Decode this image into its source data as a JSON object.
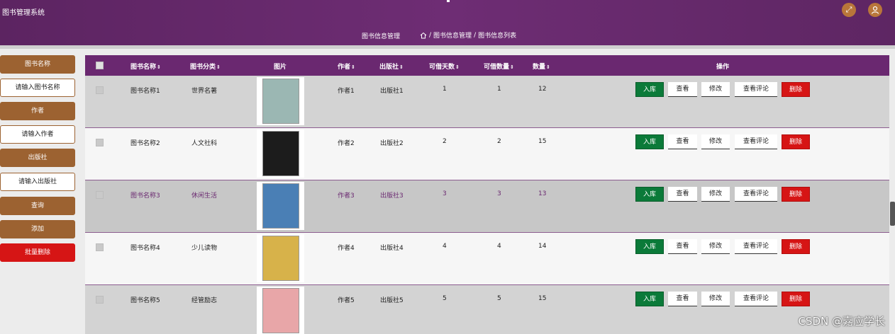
{
  "header": {
    "app_title": "图书管理系统",
    "nav_label": "图书信息管理",
    "breadcrumb": [
      "图书信息管理",
      "图书信息列表"
    ],
    "icons": [
      "fullscreen-icon",
      "user-icon"
    ],
    "accent_color": "#6a2870"
  },
  "sidebar": {
    "title_label": "图书名称",
    "title_placeholder": "请输入图书名称",
    "author_label": "作者",
    "author_placeholder": "请输入作者",
    "publisher_label": "出版社",
    "publisher_placeholder": "请输入出版社",
    "query_button": "查询",
    "add_button": "添加",
    "batch_delete_button": "批量删除"
  },
  "table": {
    "columns": {
      "name": "图书名称",
      "category": "图书分类",
      "image": "图片",
      "author": "作者",
      "publisher": "出版社",
      "borrow_days": "可借天数",
      "borrow_qty": "可借数量",
      "qty": "数量",
      "actions": "操作"
    },
    "sort_glyph": "⇕",
    "actions": {
      "stock_in": "入库",
      "view": "查看",
      "edit": "修改",
      "view_comments": "查看评论",
      "delete": "删除"
    },
    "rows": [
      {
        "name": "图书名称1",
        "category": "世界名著",
        "author": "作者1",
        "publisher": "出版社1",
        "borrow_days": "1",
        "borrow_qty": "1",
        "qty": "12",
        "cover_color": "#9bb7b3"
      },
      {
        "name": "图书名称2",
        "category": "人文社科",
        "author": "作者2",
        "publisher": "出版社2",
        "borrow_days": "2",
        "borrow_qty": "2",
        "qty": "15",
        "cover_color": "#1c1c1c"
      },
      {
        "name": "图书名称3",
        "category": "休闲生活",
        "author": "作者3",
        "publisher": "出版社3",
        "borrow_days": "3",
        "borrow_qty": "3",
        "qty": "13",
        "cover_color": "#4a7fb5"
      },
      {
        "name": "图书名称4",
        "category": "少儿读物",
        "author": "作者4",
        "publisher": "出版社4",
        "borrow_days": "4",
        "borrow_qty": "4",
        "qty": "14",
        "cover_color": "#d7b24a"
      },
      {
        "name": "图书名称5",
        "category": "经管励志",
        "author": "作者5",
        "publisher": "出版社5",
        "borrow_days": "5",
        "borrow_qty": "5",
        "qty": "15",
        "cover_color": "#e8a6a8"
      }
    ]
  },
  "watermark": "CSDN @嘉应学长"
}
